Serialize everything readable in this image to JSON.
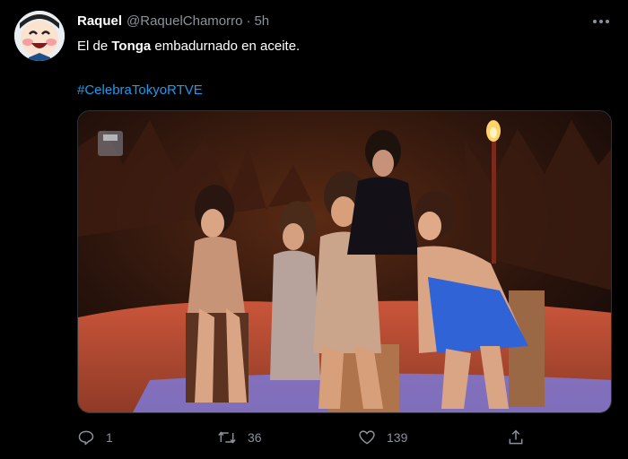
{
  "author": {
    "name": "Raquel",
    "handle": "@RaquelChamorro",
    "separator": "·",
    "time": "5h"
  },
  "tweet": {
    "text_before": "El de ",
    "text_bold": "Tonga",
    "text_after": " embadurnado en aceite.",
    "hashtag": "#CelebraTokyoRTVE"
  },
  "media": {
    "description_icon": "save-floppy-icon"
  },
  "actions": {
    "reply_count": "1",
    "retweet_count": "36",
    "like_count": "139"
  },
  "colors": {
    "background": "#000000",
    "link": "#1d9bf0",
    "muted": "#8a939b"
  }
}
